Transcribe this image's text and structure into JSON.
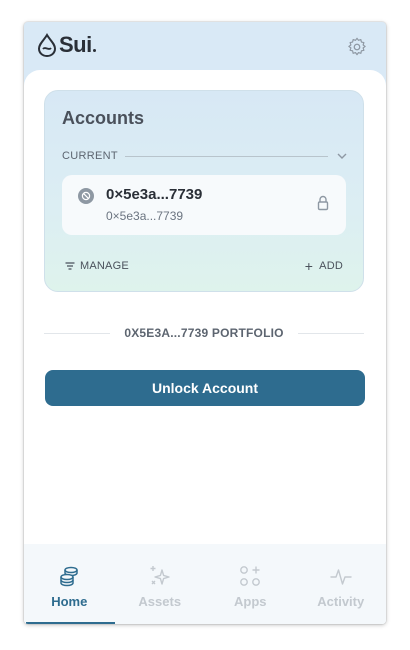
{
  "header": {
    "logo_text": "Sui"
  },
  "accounts": {
    "title": "Accounts",
    "current_label": "CURRENT",
    "account": {
      "primary": "0×5e3a...7739",
      "secondary": "0×5e3a...7739"
    },
    "manage_label": "MANAGE",
    "add_label": "ADD"
  },
  "portfolio": {
    "label": "0X5E3A...7739 PORTFOLIO"
  },
  "unlock_button": "Unlock Account",
  "nav": {
    "items": [
      {
        "label": "Home",
        "icon": "coins-icon",
        "active": true
      },
      {
        "label": "Assets",
        "icon": "sparkles-icon",
        "active": false
      },
      {
        "label": "Apps",
        "icon": "apps-icon",
        "active": false
      },
      {
        "label": "Activity",
        "icon": "activity-icon",
        "active": false
      }
    ]
  },
  "colors": {
    "accent": "#2e6c8f",
    "header_bg": "#d9e9f6",
    "inactive": "#c3c9cf"
  }
}
